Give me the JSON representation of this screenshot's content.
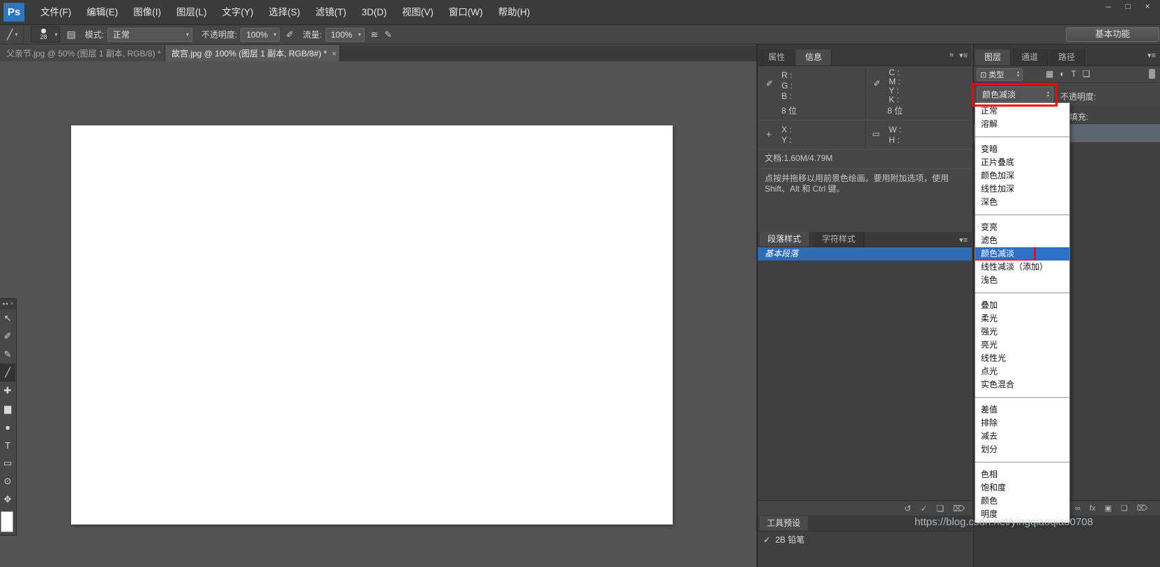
{
  "window_controls": {
    "minimize": "–",
    "maximize": "□",
    "close": "×"
  },
  "menu_bar": {
    "logo": "Ps",
    "items": [
      "文件(F)",
      "编辑(E)",
      "图像(I)",
      "图层(L)",
      "文字(Y)",
      "选择(S)",
      "滤镜(T)",
      "3D(D)",
      "视图(V)",
      "窗口(W)",
      "帮助(H)"
    ]
  },
  "options_bar": {
    "brush_size": "28",
    "mode_label": "模式:",
    "mode_value": "正常",
    "opacity_label": "不透明度:",
    "opacity_value": "100%",
    "flow_label": "流量:",
    "flow_value": "100%",
    "workspace_button": "基本功能"
  },
  "document_tabs": [
    {
      "label": "父亲节.jpg @ 50% (图层 1 副本, RGB/8) *",
      "close": "×"
    },
    {
      "label": "故宫.jpg @ 100% (图层 1 副本, RGB/8#) *",
      "close": "×"
    }
  ],
  "toolbar": {
    "header": "◂◂ ×",
    "tools": [
      {
        "name": "move-tool",
        "glyph": "↖"
      },
      {
        "name": "lasso-tool",
        "glyph": "✐"
      },
      {
        "name": "eyedropper-tool",
        "glyph": "✎"
      },
      {
        "name": "brush-tool",
        "glyph": "╱",
        "selected": true
      },
      {
        "name": "healing-brush-tool",
        "glyph": "✚"
      },
      {
        "name": "gradient-tool",
        "glyph": "▆"
      },
      {
        "name": "blur-tool",
        "glyph": "●"
      },
      {
        "name": "type-tool",
        "glyph": "T"
      },
      {
        "name": "shape-tool",
        "glyph": "▭"
      },
      {
        "name": "zoom-tool",
        "glyph": "⊙"
      },
      {
        "name": "hand-tool",
        "glyph": "✥"
      }
    ]
  },
  "info_panel": {
    "tab_properties": "属性",
    "tab_info": "信息",
    "rgb": [
      "R :",
      "G :",
      "B :"
    ],
    "cmyk": [
      "C :",
      "M :",
      "Y :",
      "K :"
    ],
    "bits_left": "8 位",
    "bits_right": "8 位",
    "xy": [
      "X :",
      "Y :"
    ],
    "wh": [
      "W :",
      "H :"
    ],
    "doc": "文档:1.60M/4.79M",
    "tip_line1": "点按并拖移以用前景色绘画。要用附加选项，使用",
    "tip_line2": "Shift、Alt 和 Ctrl 键。"
  },
  "styles_panel": {
    "tab_paragraph": "段落样式",
    "tab_character": "字符样式",
    "item": "基本段落",
    "actions": [
      {
        "name": "reset-style",
        "glyph": "↺"
      },
      {
        "name": "commit-style",
        "glyph": "✓"
      },
      {
        "name": "new-style",
        "glyph": "❏"
      },
      {
        "name": "delete-style",
        "glyph": "⌦"
      }
    ]
  },
  "tool_presets_bar": {
    "label": "工具预设",
    "check": "✓",
    "item": "2B 铅笔"
  },
  "layers_panel": {
    "tab_layers": "图层",
    "tab_channels": "通道",
    "tab_paths": "路径",
    "kind_label": "类型",
    "blend_mode_value": "颜色减淡",
    "opacity_label": "不透明度:",
    "fill_label": "填充:",
    "filter_icons": [
      {
        "name": "filter-pixel-layers",
        "glyph": "▦"
      },
      {
        "name": "filter-adjustment-layers",
        "glyph": "◐"
      },
      {
        "name": "filter-type-layers",
        "glyph": "T"
      },
      {
        "name": "filter-shape-layers",
        "glyph": "❑"
      }
    ],
    "actions": [
      {
        "name": "link-layers",
        "glyph": "∞"
      },
      {
        "name": "layer-effects",
        "glyph": "fx"
      },
      {
        "name": "add-layer-mask",
        "glyph": "▣"
      },
      {
        "name": "new-layer",
        "glyph": "❏"
      },
      {
        "name": "delete-layer",
        "glyph": "⌦"
      }
    ]
  },
  "blend_menu": {
    "selected": "颜色减淡",
    "groups": [
      [
        "正常",
        "溶解"
      ],
      [
        "变暗",
        "正片叠底",
        "颜色加深",
        "线性加深",
        "深色"
      ],
      [
        "变亮",
        "滤色",
        "颜色减淡",
        "线性减淡（添加）",
        "浅色"
      ],
      [
        "叠加",
        "柔光",
        "强光",
        "亮光",
        "线性光",
        "点光",
        "实色混合"
      ],
      [
        "差值",
        "排除",
        "减去",
        "划分"
      ],
      [
        "色相",
        "饱和度",
        "颜色",
        "明度"
      ]
    ]
  },
  "icons": {
    "chevron_down": "▾",
    "spin_up": "▲",
    "spin_down": "▼",
    "panel_menu": "▾≡",
    "collapse": "»",
    "brush_tool": "╱",
    "toggle_panels": "▤",
    "pressure_opacity": "✐",
    "airbrush": "≋",
    "pressure_size": "✎",
    "eyedropper": "✐",
    "crosshair": "+",
    "rect": "▭",
    "kind_search": "⊡"
  },
  "colors": {
    "annotation_red": "#fe0000",
    "selection_blue": "#2c70c8",
    "highlight_row_blue": "#2e6cb5"
  },
  "watermark": "https://blog.csdn.net/yingqiaoqiao0708"
}
